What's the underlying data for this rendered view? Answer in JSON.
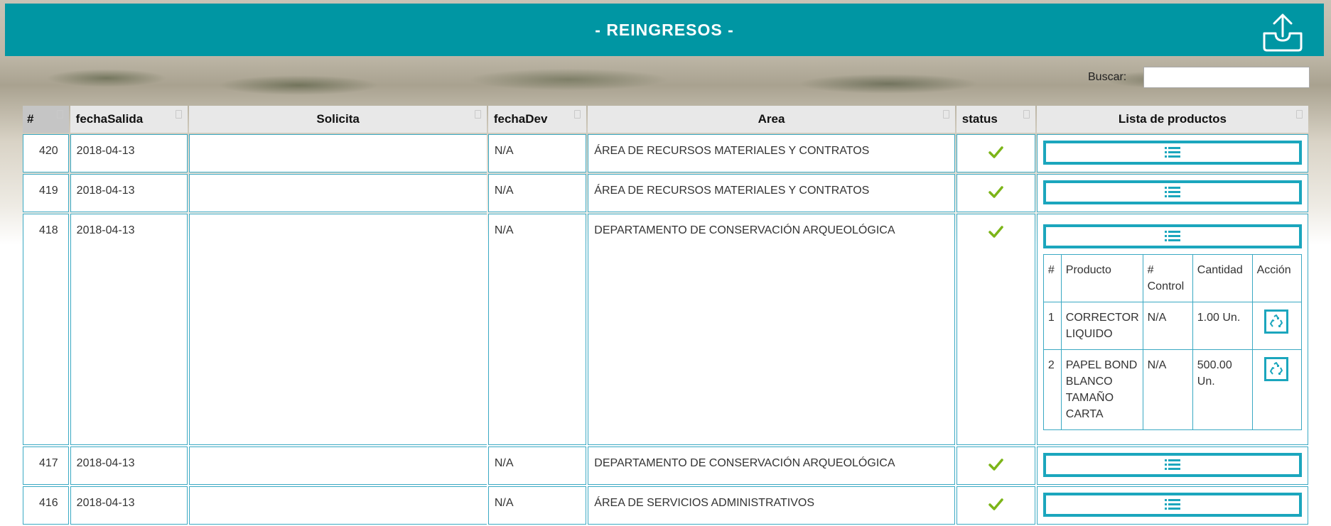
{
  "header": {
    "title": "- REINGRESOS -",
    "export_icon": "upload-tray-icon",
    "bg_color": "#0096a3"
  },
  "search": {
    "label": "Buscar:",
    "value": "",
    "placeholder": ""
  },
  "table": {
    "columns": [
      "#",
      "fechaSalida",
      "Solicita",
      "fechaDev",
      "Area",
      "status",
      "Lista de productos"
    ],
    "rows": [
      {
        "id": "420",
        "fechaSalida": "2018-04-13",
        "solicita": "",
        "fechaDev": "N/A",
        "area": "ÁREA DE RECURSOS MATERIALES Y CONTRATOS",
        "status": "check-icon"
      },
      {
        "id": "419",
        "fechaSalida": "2018-04-13",
        "solicita": "",
        "fechaDev": "N/A",
        "area": "ÁREA DE RECURSOS MATERIALES Y CONTRATOS",
        "status": "check-icon"
      },
      {
        "id": "418",
        "fechaSalida": "2018-04-13",
        "solicita": "",
        "fechaDev": "N/A",
        "area": "DEPARTAMENTO DE CONSERVACIÓN ARQUEOLÓGICA",
        "status": "check-icon",
        "productos": {
          "columns": [
            "#",
            "Producto",
            "# Control",
            "Cantidad",
            "Acción"
          ],
          "rows": [
            {
              "n": "1",
              "producto": "CORRECTOR LIQUIDO",
              "control": "N/A",
              "cantidad": "1.00 Un."
            },
            {
              "n": "2",
              "producto": "PAPEL BOND BLANCO TAMAÑO CARTA",
              "control": "N/A",
              "cantidad": "500.00 Un."
            }
          ]
        }
      },
      {
        "id": "417",
        "fechaSalida": "2018-04-13",
        "solicita": "",
        "fechaDev": "N/A",
        "area": "DEPARTAMENTO DE CONSERVACIÓN ARQUEOLÓGICA",
        "status": "check-icon"
      },
      {
        "id": "416",
        "fechaSalida": "2018-04-13",
        "solicita": "",
        "fechaDev": "N/A",
        "area": "ÁREA DE SERVICIOS ADMINISTRATIVOS",
        "status": "check-icon"
      }
    ]
  },
  "colors": {
    "accent": "#1ba6bd",
    "check": "#7cb518",
    "border": "#3aa9c3"
  }
}
